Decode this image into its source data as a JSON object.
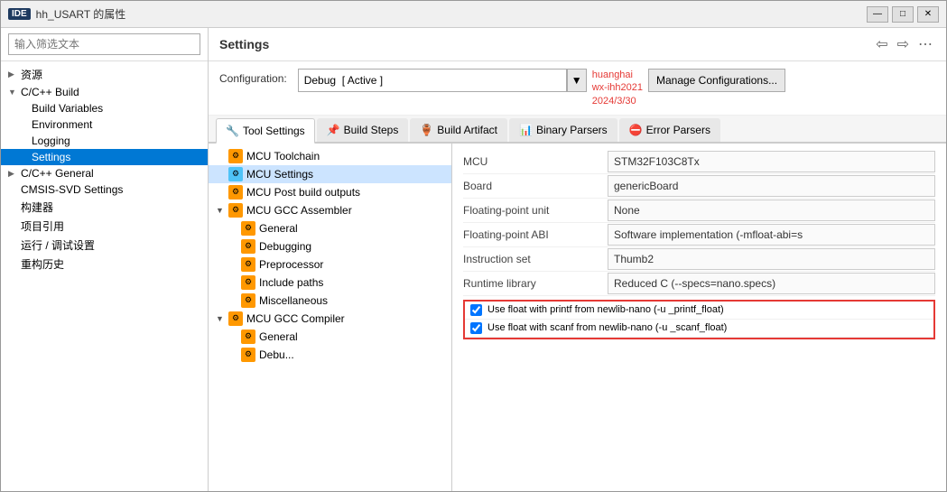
{
  "window": {
    "ide_badge": "IDE",
    "title": "hh_USART 的属性",
    "controls": [
      "—",
      "□",
      "✕"
    ]
  },
  "sidebar": {
    "search_placeholder": "输入筛选文本",
    "items": [
      {
        "label": "资源",
        "level": 0,
        "arrow": "▶",
        "indent": 0
      },
      {
        "label": "C/C++ Build",
        "level": 0,
        "arrow": "▼",
        "indent": 0
      },
      {
        "label": "Build Variables",
        "level": 1,
        "arrow": "",
        "indent": 1
      },
      {
        "label": "Environment",
        "level": 1,
        "arrow": "",
        "indent": 1
      },
      {
        "label": "Logging",
        "level": 1,
        "arrow": "",
        "indent": 1
      },
      {
        "label": "Settings",
        "level": 1,
        "arrow": "",
        "indent": 1,
        "selected": true
      },
      {
        "label": "C/C++ General",
        "level": 0,
        "arrow": "▶",
        "indent": 0
      },
      {
        "label": "CMSIS-SVD Settings",
        "level": 0,
        "arrow": "",
        "indent": 0
      },
      {
        "label": "构建器",
        "level": 0,
        "arrow": "",
        "indent": 0
      },
      {
        "label": "项目引用",
        "level": 0,
        "arrow": "",
        "indent": 0
      },
      {
        "label": "运行 / 调试设置",
        "level": 0,
        "arrow": "",
        "indent": 0
      },
      {
        "label": "重构历史",
        "level": 0,
        "arrow": "",
        "indent": 0
      }
    ]
  },
  "settings_panel": {
    "title": "Settings",
    "config_label": "Configuration:",
    "config_value": "Debug  [ Active ]",
    "watermark_line1": "huanghai",
    "watermark_line2": "wx-ihh2021",
    "watermark_line3": "2024/3/30",
    "manage_btn": "Manage Configurations..."
  },
  "tabs": [
    {
      "label": "Tool Settings",
      "icon": "🔧",
      "active": true
    },
    {
      "label": "Build Steps",
      "icon": "📌",
      "active": false
    },
    {
      "label": "Build Artifact",
      "icon": "🏺",
      "active": false
    },
    {
      "label": "Binary Parsers",
      "icon": "📊",
      "active": false
    },
    {
      "label": "Error Parsers",
      "icon": "⛔",
      "active": false
    }
  ],
  "tool_tree": [
    {
      "label": "MCU Toolchain",
      "indent": 0,
      "arrow": "",
      "icon_color": "orange",
      "selected": false
    },
    {
      "label": "MCU Settings",
      "indent": 0,
      "arrow": "",
      "icon_color": "blue",
      "selected": true
    },
    {
      "label": "MCU Post build outputs",
      "indent": 0,
      "arrow": "",
      "icon_color": "orange",
      "selected": false
    },
    {
      "label": "MCU GCC Assembler",
      "indent": 0,
      "arrow": "▼",
      "icon_color": "orange",
      "selected": false
    },
    {
      "label": "General",
      "indent": 1,
      "arrow": "",
      "icon_color": "orange",
      "selected": false
    },
    {
      "label": "Debugging",
      "indent": 1,
      "arrow": "",
      "icon_color": "orange",
      "selected": false
    },
    {
      "label": "Preprocessor",
      "indent": 1,
      "arrow": "",
      "icon_color": "orange",
      "selected": false
    },
    {
      "label": "Include paths",
      "indent": 1,
      "arrow": "",
      "icon_color": "orange",
      "selected": false
    },
    {
      "label": "Miscellaneous",
      "indent": 1,
      "arrow": "",
      "icon_color": "orange",
      "selected": false
    },
    {
      "label": "MCU GCC Compiler",
      "indent": 0,
      "arrow": "▼",
      "icon_color": "orange",
      "selected": false
    },
    {
      "label": "General",
      "indent": 1,
      "arrow": "",
      "icon_color": "orange",
      "selected": false
    },
    {
      "label": "Debu...",
      "indent": 1,
      "arrow": "",
      "icon_color": "orange",
      "selected": false
    }
  ],
  "fields": [
    {
      "label": "MCU",
      "value": "STM32F103C8Tx",
      "highlighted": false
    },
    {
      "label": "Board",
      "value": "genericBoard",
      "highlighted": false
    },
    {
      "label": "Floating-point unit",
      "value": "None",
      "highlighted": false
    },
    {
      "label": "Floating-point ABI",
      "value": "Software implementation (-mfloat-abi=s",
      "highlighted": false
    },
    {
      "label": "Instruction set",
      "value": "Thumb2",
      "highlighted": false
    },
    {
      "label": "Runtime library",
      "value": "Reduced C (--specs=nano.specs)",
      "highlighted": true
    }
  ],
  "checkboxes": [
    {
      "checked": true,
      "label": "Use float with printf from newlib-nano (-u _printf_float)"
    },
    {
      "checked": true,
      "label": "Use float with scanf from newlib-nano (-u _scanf_float)"
    }
  ]
}
